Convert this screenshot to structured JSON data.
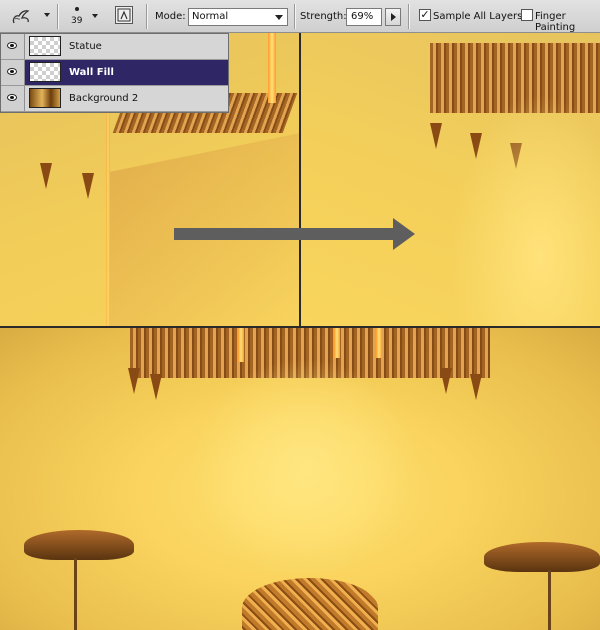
{
  "options_bar": {
    "brush_size": "39",
    "mode_label": "Mode:",
    "mode_value": "Normal",
    "strength_label": "Strength:",
    "strength_value": "69%",
    "sample_all_layers_label": "Sample All Layers",
    "sample_all_layers_checked": true,
    "finger_painting_label": "Finger Painting",
    "finger_painting_checked": false
  },
  "layers": [
    {
      "name": "Statue",
      "selected": false,
      "visible": true,
      "thumbnail": "transparent"
    },
    {
      "name": "Wall Fill",
      "selected": true,
      "visible": true,
      "thumbnail": "transparent"
    },
    {
      "name": "Background 2",
      "selected": false,
      "visible": true,
      "thumbnail": "image"
    }
  ],
  "icons": {
    "tool": "smudge-finger-icon",
    "brush": "brush-tip-icon",
    "brush_toggle": "brush-panel-toggle-icon",
    "layer_visibility": "eye-icon",
    "strength_slider": "slider-arrow-icon",
    "transition": "right-arrow-icon"
  },
  "colors": {
    "selected_layer": "#2f2666",
    "canvas_gold": "#f1cf59",
    "arrow": "#5e5e5e"
  }
}
